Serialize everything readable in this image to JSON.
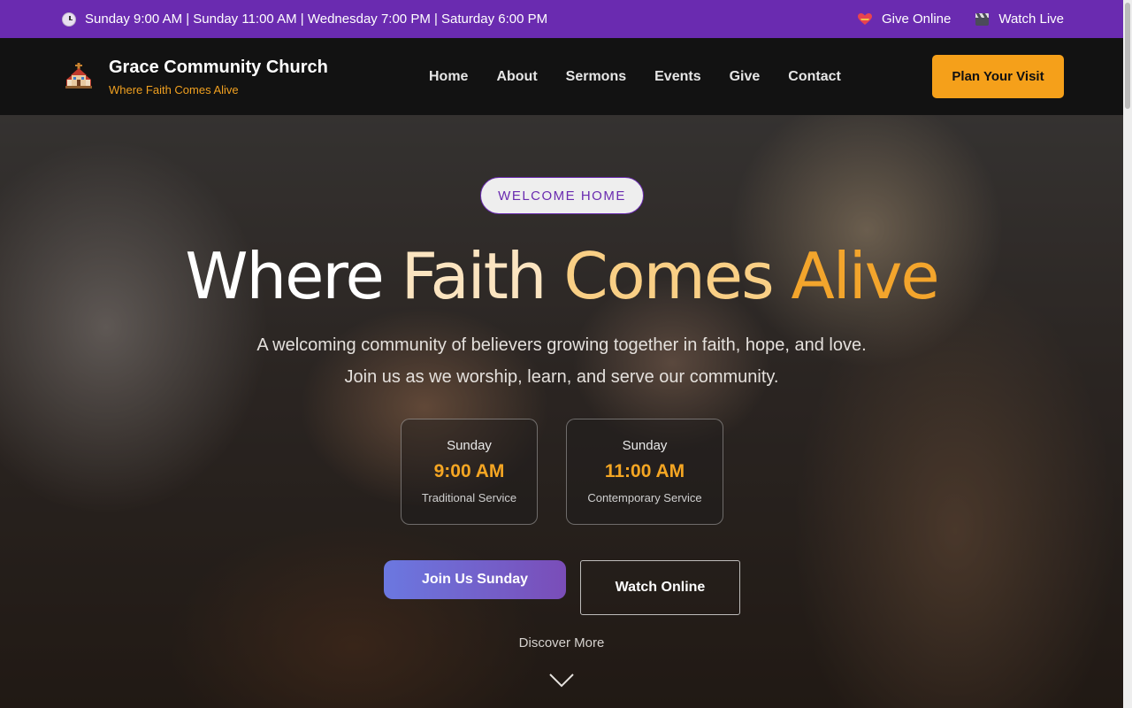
{
  "topbar": {
    "schedule": "Sunday 9:00 AM | Sunday 11:00 AM | Wednesday 7:00 PM | Saturday 6:00 PM",
    "give_online": "Give Online",
    "watch_live": "Watch Live"
  },
  "header": {
    "brand_name": "Grace Community Church",
    "tagline": "Where Faith Comes Alive",
    "nav": [
      "Home",
      "About",
      "Sermons",
      "Events",
      "Give",
      "Contact"
    ],
    "cta": "Plan Your Visit"
  },
  "hero": {
    "badge": "WELCOME HOME",
    "headline_words": [
      "Where",
      "Faith",
      "Comes",
      "Alive"
    ],
    "subtitle": "A welcoming community of believers growing together in faith, hope, and love. Join us as we worship, learn, and serve our community.",
    "services": [
      {
        "day": "Sunday",
        "time": "9:00 AM",
        "kind": "Traditional Service"
      },
      {
        "day": "Sunday",
        "time": "11:00 AM",
        "kind": "Contemporary Service"
      }
    ],
    "join_button": "Join Us Sunday",
    "watch_button": "Watch Online",
    "discover": "Discover More"
  },
  "colors": {
    "topbar": "#6a2bb0",
    "accent": "#f5a01a",
    "header": "#121212"
  },
  "icons": [
    "clock-icon",
    "heart-icon",
    "clapperboard-icon",
    "church-icon",
    "chevron-down-icon"
  ]
}
